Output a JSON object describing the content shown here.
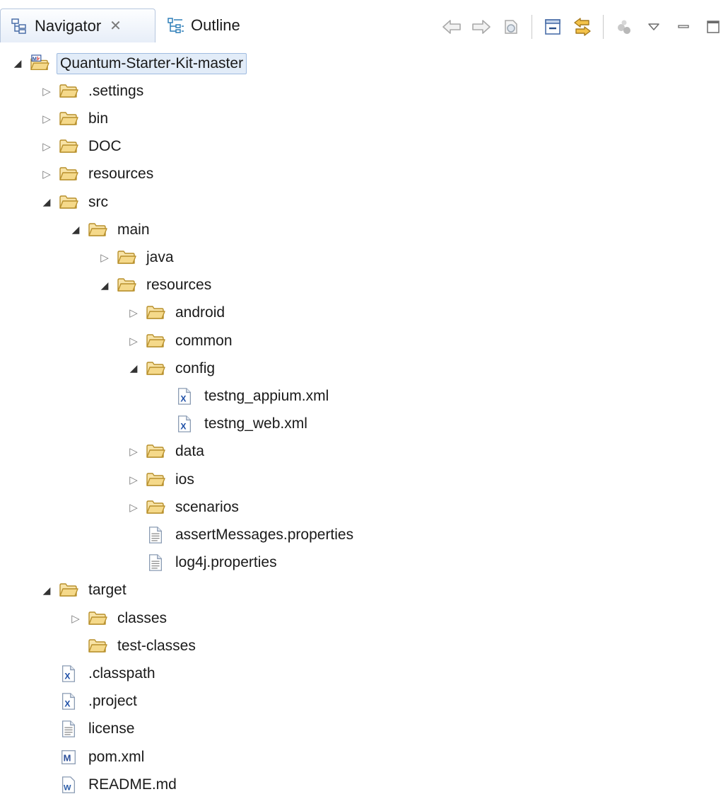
{
  "tabs": {
    "navigator": {
      "label": "Navigator",
      "icon": "navigator-icon",
      "close_glyph": "✕"
    },
    "outline": {
      "label": "Outline",
      "icon": "outline-icon"
    }
  },
  "toolbar": {
    "buttons": [
      "back-arrow-icon",
      "forward-arrow-icon",
      "up-icon",
      "collapse-all-icon",
      "link-with-editor-icon",
      "filter-icon",
      "view-menu-icon",
      "minimize-icon",
      "maximize-icon"
    ]
  },
  "colors": {
    "folder_fill": "#f5d98a",
    "folder_stroke": "#b8902c",
    "selection_bg": "#e2ecf8",
    "selection_border": "#9fbbe0",
    "xml_icon": "#1d4ea6",
    "maven_icon": "#2b4f9a"
  },
  "tree": [
    {
      "label": "Quantum-Starter-Kit-master",
      "depth": 0,
      "twisty": "open",
      "icon": "project-icon",
      "selected": true
    },
    {
      "label": ".settings",
      "depth": 1,
      "twisty": "closed",
      "icon": "folder-icon"
    },
    {
      "label": "bin",
      "depth": 1,
      "twisty": "closed",
      "icon": "folder-icon"
    },
    {
      "label": "DOC",
      "depth": 1,
      "twisty": "closed",
      "icon": "folder-icon"
    },
    {
      "label": "resources",
      "depth": 1,
      "twisty": "closed",
      "icon": "folder-icon"
    },
    {
      "label": "src",
      "depth": 1,
      "twisty": "open",
      "icon": "folder-icon"
    },
    {
      "label": "main",
      "depth": 2,
      "twisty": "open",
      "icon": "folder-icon"
    },
    {
      "label": "java",
      "depth": 3,
      "twisty": "closed",
      "icon": "folder-icon"
    },
    {
      "label": "resources",
      "depth": 3,
      "twisty": "open",
      "icon": "folder-icon"
    },
    {
      "label": "android",
      "depth": 4,
      "twisty": "closed",
      "icon": "folder-icon"
    },
    {
      "label": "common",
      "depth": 4,
      "twisty": "closed",
      "icon": "folder-icon"
    },
    {
      "label": "config",
      "depth": 4,
      "twisty": "open",
      "icon": "folder-icon"
    },
    {
      "label": "testng_appium.xml",
      "depth": 5,
      "twisty": "none",
      "icon": "xml-file-icon"
    },
    {
      "label": "testng_web.xml",
      "depth": 5,
      "twisty": "none",
      "icon": "xml-file-icon"
    },
    {
      "label": "data",
      "depth": 4,
      "twisty": "closed",
      "icon": "folder-icon"
    },
    {
      "label": "ios",
      "depth": 4,
      "twisty": "closed",
      "icon": "folder-icon"
    },
    {
      "label": "scenarios",
      "depth": 4,
      "twisty": "closed",
      "icon": "folder-icon"
    },
    {
      "label": "assertMessages.properties",
      "depth": 4,
      "twisty": "none",
      "icon": "text-file-icon"
    },
    {
      "label": "log4j.properties",
      "depth": 4,
      "twisty": "none",
      "icon": "text-file-icon"
    },
    {
      "label": "target",
      "depth": 1,
      "twisty": "open",
      "icon": "folder-icon"
    },
    {
      "label": "classes",
      "depth": 2,
      "twisty": "closed",
      "icon": "folder-icon"
    },
    {
      "label": "test-classes",
      "depth": 2,
      "twisty": "none",
      "icon": "folder-icon"
    },
    {
      "label": ".classpath",
      "depth": 1,
      "twisty": "none",
      "icon": "xml-file-icon"
    },
    {
      "label": ".project",
      "depth": 1,
      "twisty": "none",
      "icon": "xml-file-icon"
    },
    {
      "label": "license",
      "depth": 1,
      "twisty": "none",
      "icon": "text-file-icon"
    },
    {
      "label": "pom.xml",
      "depth": 1,
      "twisty": "none",
      "icon": "maven-file-icon"
    },
    {
      "label": "README.md",
      "depth": 1,
      "twisty": "none",
      "icon": "word-file-icon"
    }
  ]
}
